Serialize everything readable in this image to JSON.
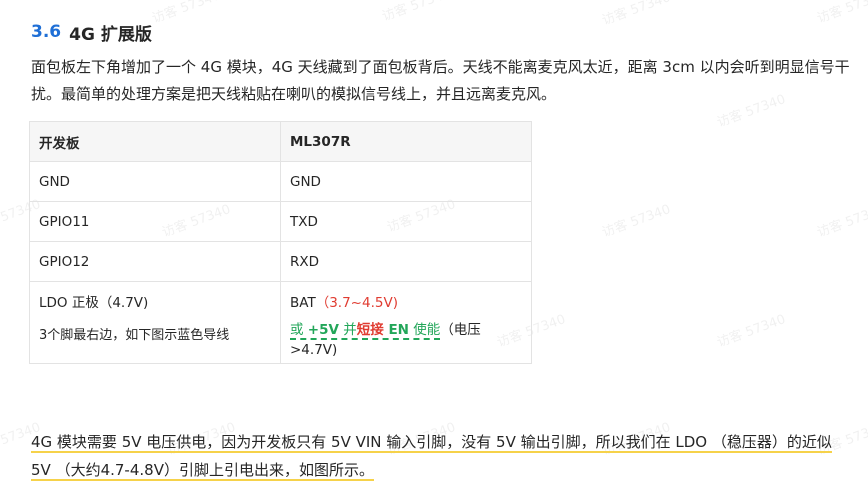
{
  "section": {
    "number": "3.6",
    "title": "4G 扩展版"
  },
  "intro_paragraph": "面包板左下角增加了一个 4G 模块，4G 天线藏到了面包板背后。天线不能离麦克风太近，距离 3cm 以内会听到明显信号干扰。最简单的处理方案是把天线粘贴在喇叭的模拟信号线上，并且远离麦克风。",
  "table": {
    "headers": [
      "开发板",
      "ML307R"
    ],
    "rows": [
      [
        "GND",
        "GND"
      ],
      [
        "GPIO11",
        "TXD"
      ],
      [
        "GPIO12",
        "RXD"
      ]
    ],
    "last_row": {
      "left_main": "LDO 正极（4.7V)",
      "left_note": "3个脚最右边，如下图示蓝色导线",
      "right_main": "BAT",
      "right_range": "（3.7~4.5V)",
      "right_or": "或 ",
      "right_5v": "+5V",
      "right_and": " 并",
      "right_short": "短接",
      "right_en": " EN",
      "right_enable": " 使能",
      "right_voltage_note": "（电压 >4.7V)"
    }
  },
  "bottom_paragraph": "4G 模块需要 5V 电压供电，因为开发板只有 5V VIN 输入引脚，没有 5V 输出引脚，所以我们在 LDO （稳压器）的近似 5V （大约4.7-4.8V）引脚上引电出来，如图所示。",
  "watermark_text": "访客 57340",
  "colors": {
    "heading_number": "#1f6fd6",
    "warning_red": "#e03c31",
    "highlight_green": "#22a659",
    "underline_yellow": "#f6d24a"
  }
}
